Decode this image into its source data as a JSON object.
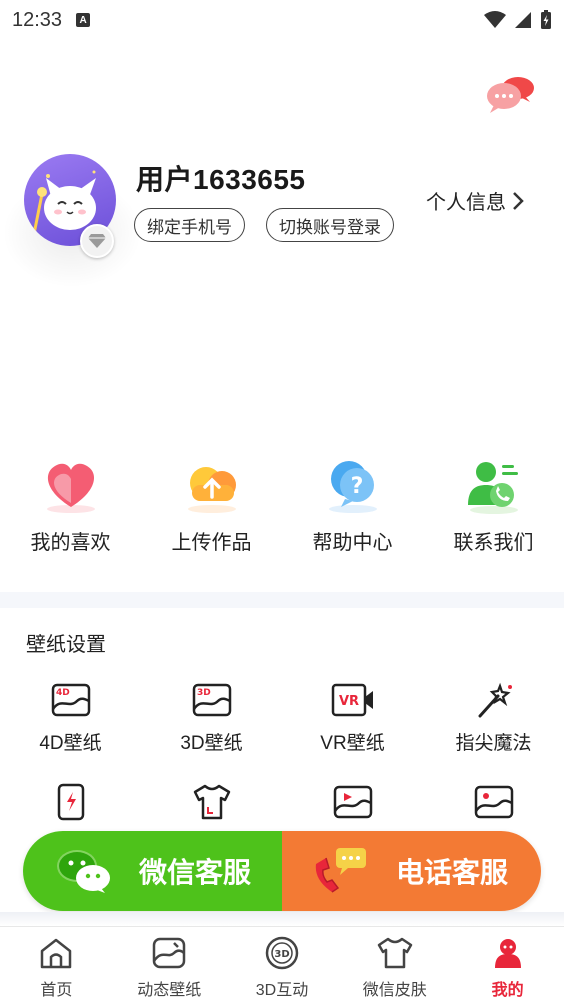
{
  "status_bar": {
    "time": "12:33",
    "notification_badge": "A"
  },
  "profile": {
    "username": "用户1633655",
    "bind_phone_label": "绑定手机号",
    "switch_account_label": "切换账号登录",
    "personal_info_label": "个人信息"
  },
  "quick_actions": [
    {
      "label": "我的喜欢",
      "icon": "heart-icon"
    },
    {
      "label": "上传作品",
      "icon": "upload-cloud-icon"
    },
    {
      "label": "帮助中心",
      "icon": "help-bubble-icon"
    },
    {
      "label": "联系我们",
      "icon": "contact-person-icon"
    }
  ],
  "wallpaper_settings": {
    "title": "壁纸设置",
    "row1": [
      {
        "label": "4D壁纸",
        "icon": "4d-wallpaper-icon",
        "tag": "4D"
      },
      {
        "label": "3D壁纸",
        "icon": "3d-wallpaper-icon",
        "tag": "3D"
      },
      {
        "label": "VR壁纸",
        "icon": "vr-wallpaper-icon",
        "tag": "VR"
      },
      {
        "label": "指尖魔法",
        "icon": "magic-wand-icon"
      }
    ],
    "row2": [
      {
        "icon": "phone-charge-icon"
      },
      {
        "icon": "tshirt-icon"
      },
      {
        "icon": "video-wallpaper-icon"
      },
      {
        "icon": "image-wallpaper-icon"
      }
    ]
  },
  "service": {
    "wechat_label": "微信客服",
    "phone_label": "电话客服",
    "wechat_color": "#4ec21b",
    "phone_color": "#f37a34"
  },
  "tabs": [
    {
      "label": "首页",
      "icon": "home-icon"
    },
    {
      "label": "动态壁纸",
      "icon": "dynamic-wallpaper-icon"
    },
    {
      "label": "3D互动",
      "icon": "3d-interact-icon"
    },
    {
      "label": "微信皮肤",
      "icon": "wechat-skin-icon"
    },
    {
      "label": "我的",
      "icon": "mine-icon",
      "active": true
    }
  ],
  "colors": {
    "accent": "#e8263a"
  }
}
